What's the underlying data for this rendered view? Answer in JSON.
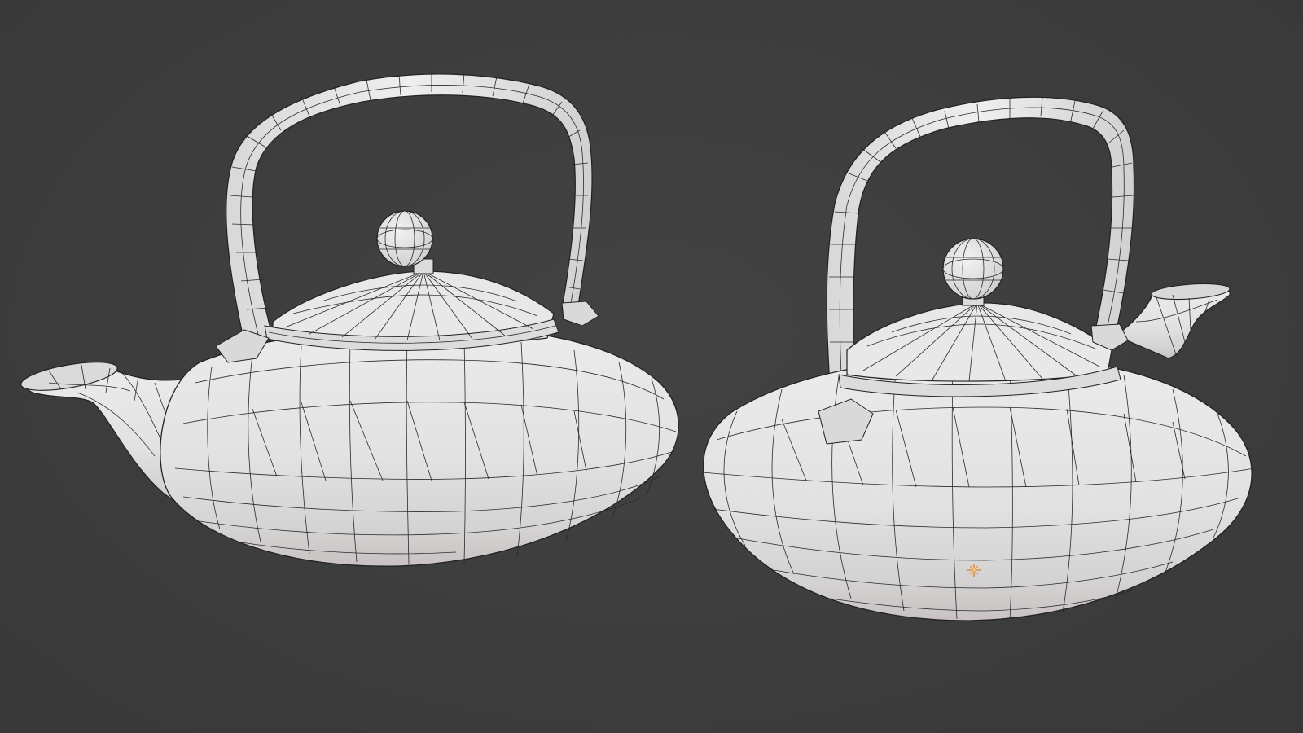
{
  "viewport": {
    "name": "3D Viewport",
    "background_color": "#3d3d3d",
    "shading": "solid-wireframe-overlay",
    "mesh_color": "#e4e4e4"
  },
  "objects": [
    {
      "id": "teapot-left",
      "type": "mesh",
      "description_icon": "teapot-mesh"
    },
    {
      "id": "teapot-right",
      "type": "mesh",
      "description_icon": "teapot-mesh"
    }
  ],
  "origin_marker": {
    "icon": "object-origin-icon",
    "color": "#e08a3c"
  }
}
